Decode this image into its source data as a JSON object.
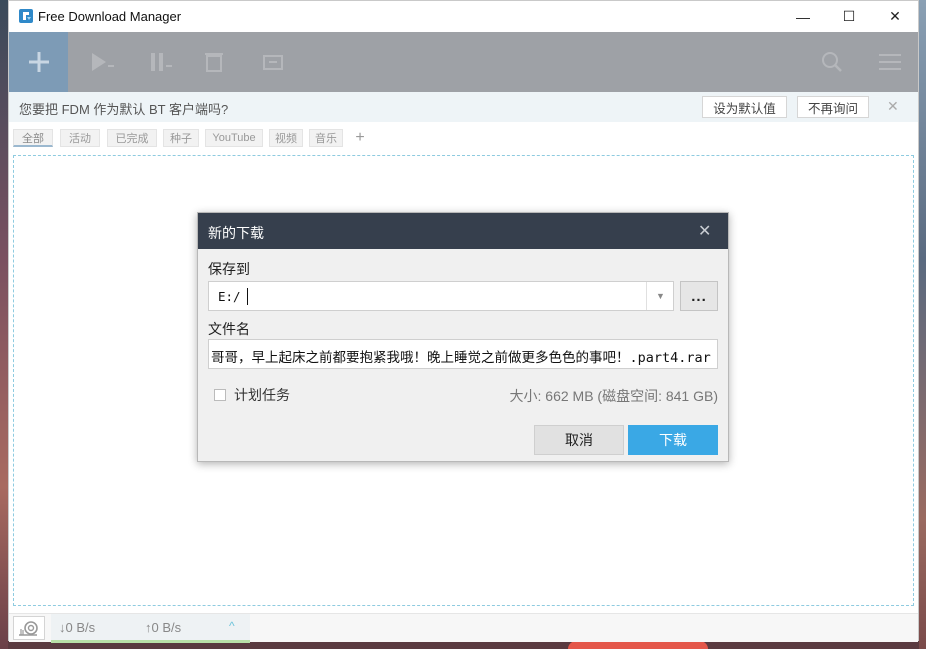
{
  "window": {
    "title": "Free Download Manager",
    "min_glyph": "—",
    "max_glyph": "☐",
    "close_glyph": "✕"
  },
  "toolbar": {
    "add_glyph": "+",
    "icons": [
      "play-icon",
      "pause-icon",
      "delete-icon",
      "move-icon",
      "search-icon",
      "menu-icon"
    ]
  },
  "bt_prompt": {
    "message": "您要把 FDM 作为默认 BT 客户端吗?",
    "set_default": "设为默认值",
    "never_ask": "不再询问",
    "close": "✕"
  },
  "tabs": [
    "全部",
    "活动",
    "已完成",
    "种子",
    "YouTube",
    "视频",
    "音乐"
  ],
  "tab_add": "+",
  "status": {
    "download_speed": "↓0 B/s",
    "upload_speed": "↑0 B/s",
    "expand": "^"
  },
  "dialog": {
    "title": "新的下载",
    "close": "✕",
    "save_to_label": "保存到",
    "save_path": "E:/",
    "browse": "...",
    "dropdown": "▼",
    "filename_label": "文件名",
    "filename": "哥哥，早上起床之前都要抱紧我哦！晚上睡觉之前做更多色色的事吧！.part4.rar",
    "schedule_label": "计划任务",
    "size_info": "大小: 662 MB (磁盘空间: 841 GB)",
    "cancel": "取消",
    "download": "下载"
  },
  "colors": {
    "toolbar_bg": "#9ea1a6",
    "add_button_bg": "#7d9bb6",
    "dialog_header": "#363f4d",
    "primary_button": "#3aa8e5"
  }
}
